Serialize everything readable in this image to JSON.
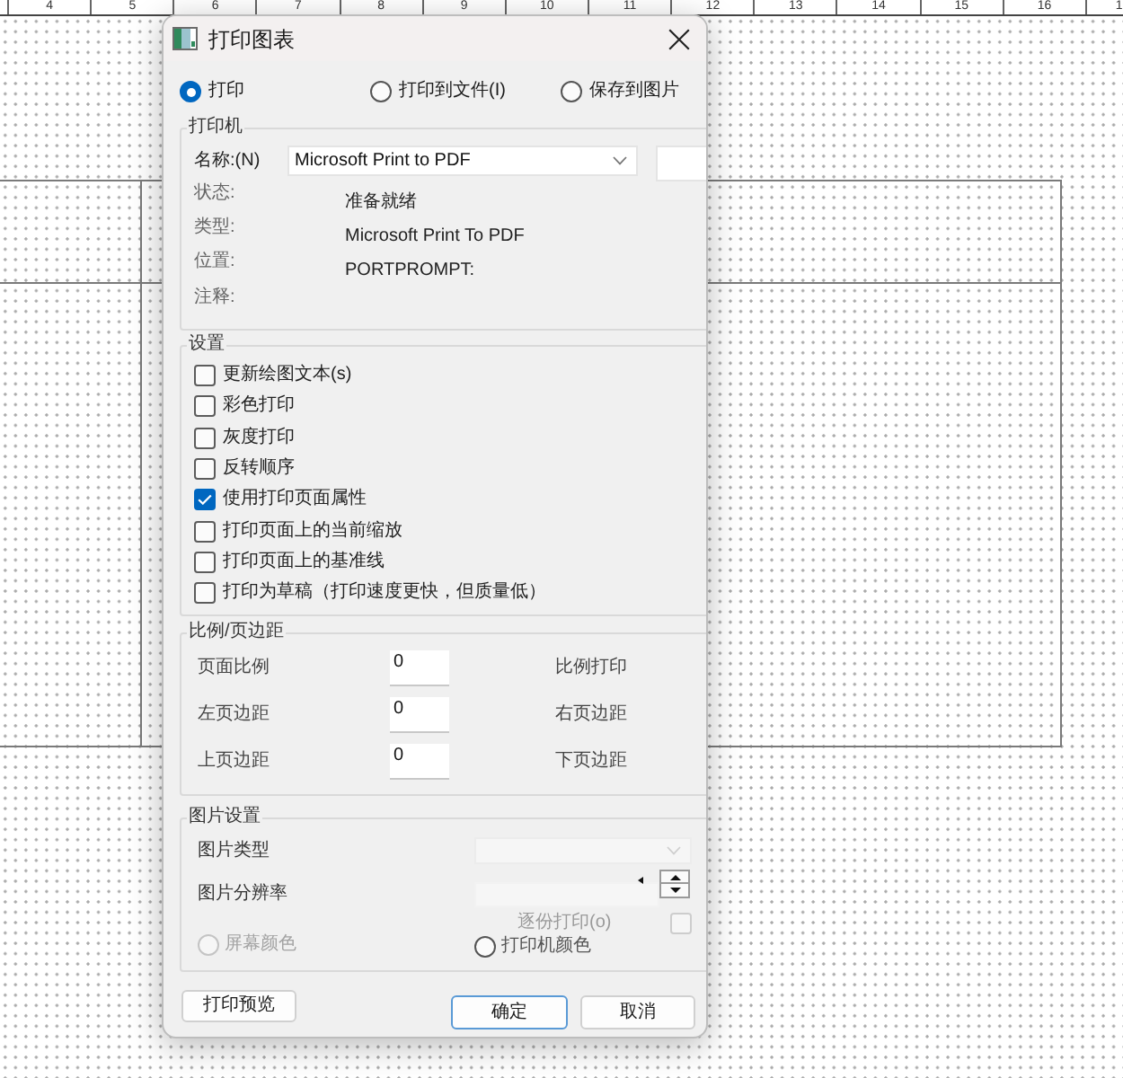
{
  "ruler": {
    "labels": [
      "4",
      "5",
      "6",
      "7",
      "8",
      "9",
      "10",
      "11",
      "12",
      "13",
      "14",
      "15",
      "16",
      "1"
    ]
  },
  "dialog": {
    "title": "打印图表",
    "modes": [
      {
        "label": "打印",
        "selected": true
      },
      {
        "label": "打印到文件(I)",
        "selected": false
      },
      {
        "label": "保存到图片",
        "selected": false
      }
    ],
    "printer": {
      "title": "打印机",
      "name_label": "名称:(N)",
      "name_value": "Microsoft Print to PDF",
      "fields": [
        {
          "label": "状态:",
          "value": "准备就绪"
        },
        {
          "label": "类型:",
          "value": "Microsoft Print To PDF"
        },
        {
          "label": "位置:",
          "value": "PORTPROMPT:"
        },
        {
          "label": "注释:"
        }
      ]
    },
    "settings": {
      "title": "设置",
      "options": [
        {
          "label": "更新绘图文本(s)",
          "checked": false
        },
        {
          "label": "彩色打印",
          "checked": false
        },
        {
          "label": "灰度打印",
          "checked": false
        },
        {
          "label": "反转顺序",
          "checked": false
        },
        {
          "label": "使用打印页面属性",
          "checked": true
        },
        {
          "label": "打印页面上的当前缩放",
          "checked": false
        },
        {
          "label": "打印页面上的基准线",
          "checked": false
        },
        {
          "label": "打印为草稿（打印速度更快，但质量低）",
          "checked": false
        }
      ]
    },
    "scale_margins": {
      "title": "比例/页边距",
      "rows": [
        {
          "label": "页面比例",
          "value": "0",
          "right_label": "比例打印"
        },
        {
          "label": "左页边距",
          "value": "0",
          "right_label": "右页边距"
        },
        {
          "label": "上页边距",
          "value": "0",
          "right_label": "下页边距"
        }
      ]
    },
    "image_settings": {
      "title": "图片设置",
      "type": {
        "label": "图片类型",
        "disabled": true
      },
      "resolution": {
        "label": "图片分辨率",
        "disabled": true
      },
      "collate": {
        "label": "逐份打印(o)",
        "checked": false,
        "disabled": true
      },
      "color_modes": [
        {
          "label": "屏幕颜色",
          "selected": false,
          "disabled": true
        },
        {
          "label": "打印机颜色",
          "selected": false,
          "disabled": false
        }
      ]
    },
    "buttons": [
      {
        "label": "打印预览",
        "default": false
      },
      {
        "label": "确定",
        "default": true
      },
      {
        "label": "取消",
        "default": false
      }
    ]
  }
}
